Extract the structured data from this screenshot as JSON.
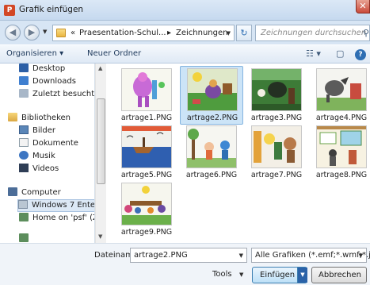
{
  "window": {
    "title": "Grafik einfügen",
    "app_icon_letter": "P",
    "close_glyph": "✕"
  },
  "address": {
    "crumb_prefix": "«",
    "crumbs": [
      "Praesentation-Schul...",
      "Zeichnungen"
    ],
    "separator": "▸",
    "search_placeholder": "Zeichnungen durchsuchen"
  },
  "toolbar": {
    "organize": "Organisieren ▾",
    "new_folder": "Neuer Ordner"
  },
  "nav": {
    "favorites": [
      "Desktop",
      "Downloads",
      "Zuletzt besucht"
    ],
    "libraries_label": "Bibliotheken",
    "libraries": [
      "Bilder",
      "Dokumente",
      "Musik",
      "Videos"
    ],
    "computer_label": "Computer",
    "drives": [
      "Windows 7 Enter",
      "Home on 'psf' (Z"
    ]
  },
  "files": [
    {
      "name": "artrage1.PNG",
      "selected": false
    },
    {
      "name": "artrage2.PNG",
      "selected": true
    },
    {
      "name": "artrage3.PNG",
      "selected": false
    },
    {
      "name": "artrage4.PNG",
      "selected": false
    },
    {
      "name": "artrage5.PNG",
      "selected": false
    },
    {
      "name": "artrage6.PNG",
      "selected": false
    },
    {
      "name": "artrage7.PNG",
      "selected": false
    },
    {
      "name": "artrage8.PNG",
      "selected": false
    },
    {
      "name": "artrage9.PNG",
      "selected": false
    }
  ],
  "bottom": {
    "filename_label": "Dateiname:",
    "filename_value": "artrage2.PNG",
    "filetype_value": "Alle Grafiken (*.emf;*.wmf;*.jpg",
    "tools_label": "Tools",
    "insert_label": "Einfügen",
    "cancel_label": "Abbrechen"
  }
}
